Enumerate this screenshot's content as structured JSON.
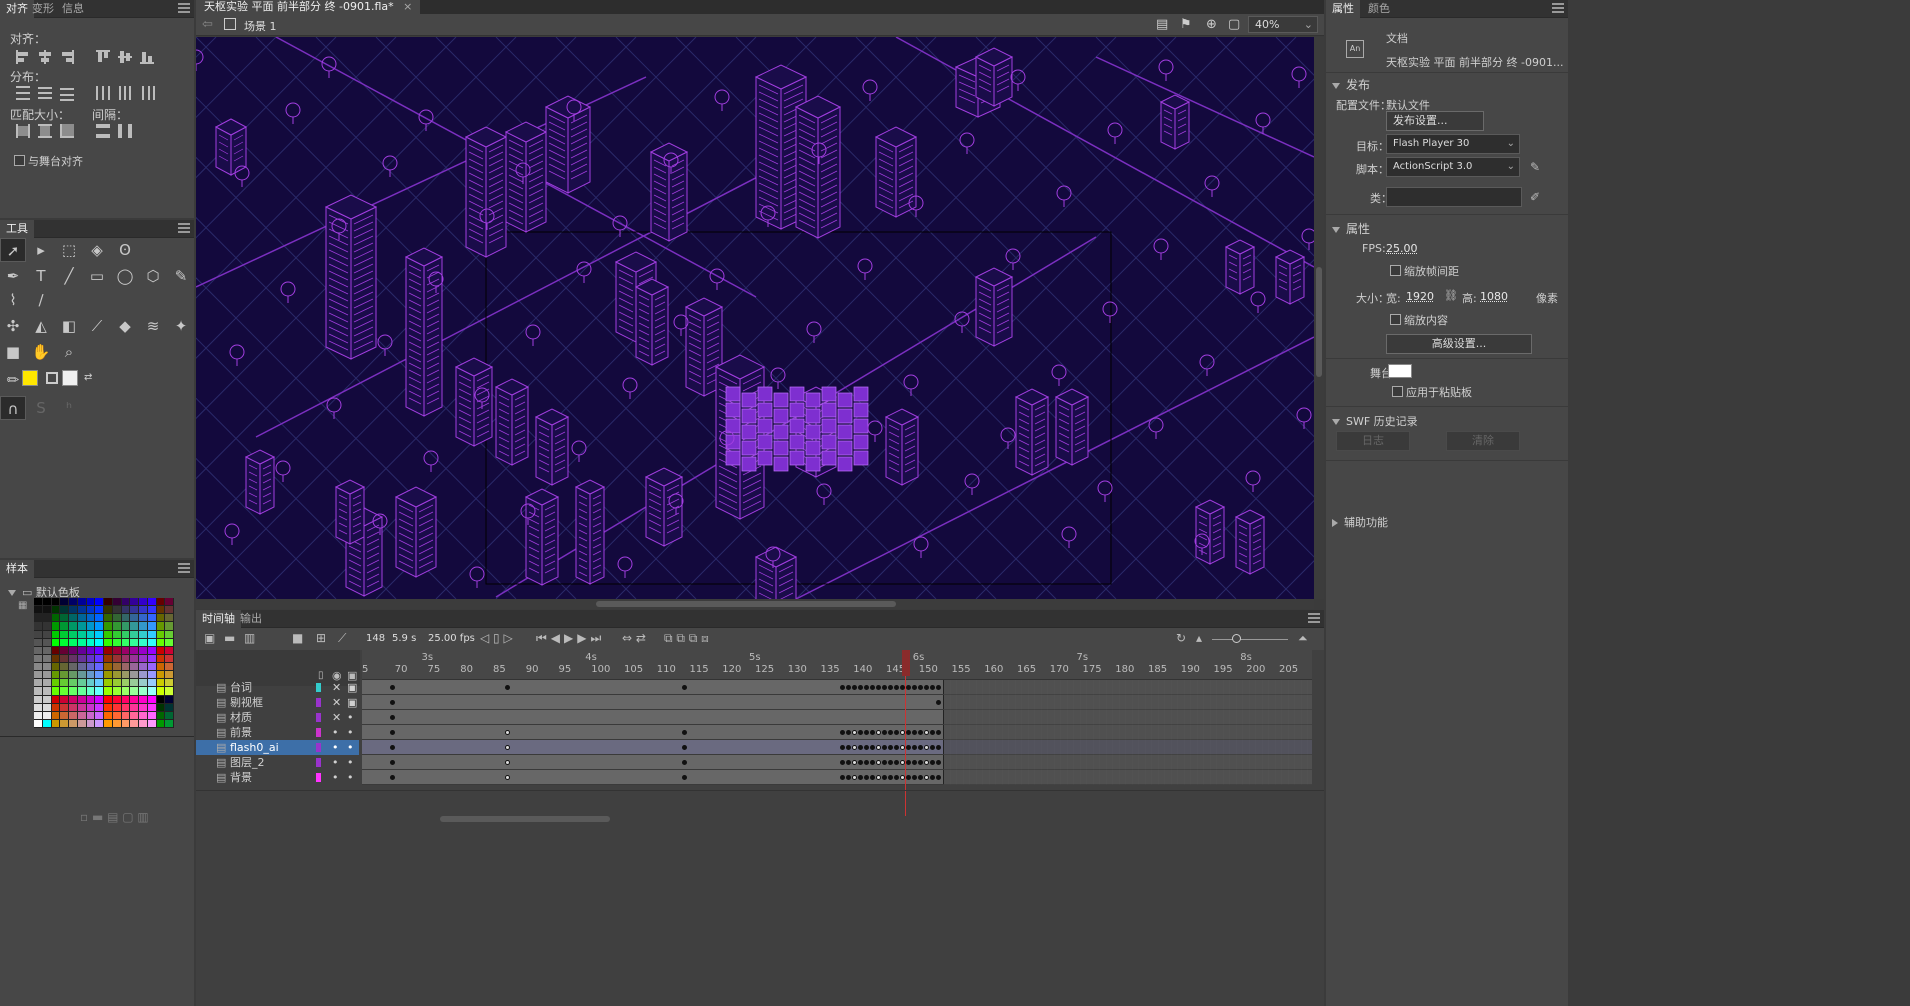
{
  "left_panel": {
    "tabs": [
      "对齐",
      "变形",
      "信息"
    ],
    "align": {
      "label_align": "对齐：",
      "label_distribute": "分布：",
      "label_match_size": "匹配大小：",
      "label_spacing": "间隔：",
      "stage_align": "与舞台对齐"
    },
    "tools_title": "工具",
    "samples_title": "样本",
    "swatch_group": "默认色板"
  },
  "document": {
    "tab_title": "天枢实验 平面 前半部分 终 -0901.fla*",
    "scene": "场景 1",
    "zoom": "40%"
  },
  "timeline": {
    "tabs": [
      "时间轴",
      "输出"
    ],
    "current_frame": "148",
    "time": "5.9 s",
    "fps": "25.00 fps",
    "ruler_seconds": [
      "3s",
      "4s",
      "5s",
      "6s",
      "7s",
      "8s"
    ],
    "ruler_frames": [
      "5",
      "70",
      "75",
      "80",
      "85",
      "90",
      "95",
      "100",
      "105",
      "110",
      "115",
      "120",
      "125",
      "130",
      "135",
      "140",
      "145",
      "150",
      "155",
      "160",
      "165",
      "170",
      "175",
      "180",
      "185",
      "190",
      "195",
      "200",
      "205"
    ],
    "layers": [
      {
        "name": "台词",
        "color": "#33cccc",
        "visible": "x",
        "locked": true
      },
      {
        "name": "剔视框",
        "color": "#9933cc",
        "visible": "x",
        "locked": true
      },
      {
        "name": "材质",
        "color": "#9933cc",
        "visible": "x",
        "locked": false
      },
      {
        "name": "前景",
        "color": "#cc33cc",
        "visible": "•",
        "locked": false
      },
      {
        "name": "flash0_ai",
        "color": "#9933cc",
        "visible": "•",
        "locked": false
      },
      {
        "name": "图层_2",
        "color": "#9933cc",
        "visible": "•",
        "locked": false
      },
      {
        "name": "背景",
        "color": "#ff33ff",
        "visible": "•",
        "locked": false
      }
    ]
  },
  "right_panel": {
    "tabs": [
      "属性",
      "颜色"
    ],
    "doc_type": "文档",
    "doc_name": "天枢实验 平面 前半部分 终 -0901...",
    "publish_section": "发布",
    "profile_label": "配置文件：",
    "profile_value": "默认文件",
    "publish_settings_btn": "发布设置...",
    "target_label": "目标：",
    "target_value": "Flash Player 30",
    "script_label": "脚本：",
    "script_value": "ActionScript 3.0",
    "class_label": "类：",
    "properties_section": "属性",
    "fps_label": "FPS:",
    "fps_value": "25.00",
    "scale_spans": "缩放帧间距",
    "size_label": "大小：",
    "width_label": "宽:",
    "width_value": "1920",
    "height_label": "高:",
    "height_value": "1080",
    "unit": "像素",
    "scale_content": "缩放内容",
    "advanced_btn": "高级设置...",
    "stage_label": "舞台：",
    "stage_color": "#ffffff",
    "apply_pasteboard": "应用于粘贴板",
    "swf_history": "SWF 历史记录",
    "log_btn": "日志",
    "clear_btn": "清除",
    "accessibility": "辅助功能"
  }
}
